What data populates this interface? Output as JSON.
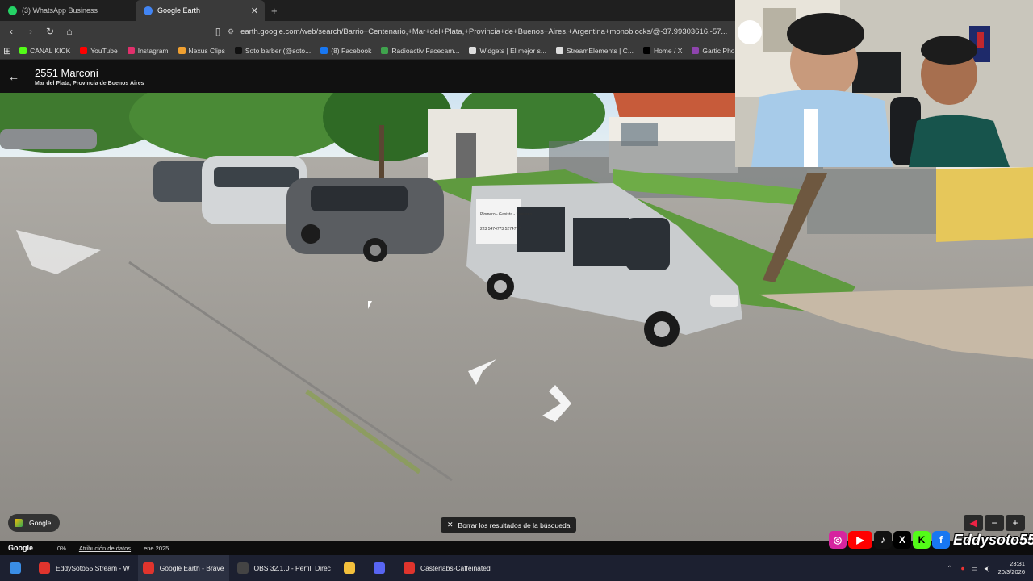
{
  "browser": {
    "tabs": [
      {
        "label": "(3) WhatsApp Business",
        "icon": "whatsapp-icon",
        "color": "#25d366"
      },
      {
        "label": "Google Earth",
        "icon": "google-earth-icon",
        "color": "#4285f4"
      }
    ],
    "url": "earth.google.com/web/search/Barrio+Centenario,+Mar+del+Plata,+Provincia+de+Buenos+Aires,+Argentina+monoblocks/@-37.99303616,-57...",
    "bookmarks": [
      {
        "label": "CANAL KICK",
        "color": "#53fc18"
      },
      {
        "label": "YouTube",
        "color": "#ff0000"
      },
      {
        "label": "Instagram",
        "color": "#e1306c"
      },
      {
        "label": "Nexus Clips",
        "color": "#f0a030"
      },
      {
        "label": "Soto barber (@soto...",
        "color": "#111111"
      },
      {
        "label": "(8) Facebook",
        "color": "#1877f2"
      },
      {
        "label": "Radioactiv Facecam...",
        "color": "#3fa34d"
      },
      {
        "label": "Widgets | El mejor s...",
        "color": "#dddddd"
      },
      {
        "label": "StreamElements | C...",
        "color": "#dddddd"
      },
      {
        "label": "Home / X",
        "color": "#000000"
      },
      {
        "label": "Gartic Phone - Tele",
        "color": "#8e44ad"
      }
    ]
  },
  "earth": {
    "place_title": "2551 Marconi",
    "place_subtitle": "Mar del Plata, Provincia de Buenos Aires",
    "google_chip": "Google",
    "clear_search": "Borrar los resultados de la búsqueda",
    "footer": {
      "brand": "Google",
      "percent": "0%",
      "attribution": "Atribución de datos",
      "date": "ene 2025"
    },
    "van_text": [
      "Plomero - Gasista - Sanitario",
      "223 5474773 5274777"
    ]
  },
  "overlay": {
    "streamer_name": "Eddysoto55"
  },
  "taskbar": {
    "items": [
      {
        "label": "EddySoto55 Stream - W",
        "color": "#e0342d"
      },
      {
        "label": "Google Earth - Brave",
        "color": "#e0342d"
      },
      {
        "label": "OBS 32.1.0 - Perfil: Direc",
        "color": "#444444"
      },
      {
        "label": "",
        "color": "#f3c03c"
      },
      {
        "label": "",
        "color": "#5865f2"
      },
      {
        "label": "Casterlabs-Caffeinated",
        "color": "#e0342d"
      }
    ],
    "time": "23:31",
    "date": "20/3/2026"
  }
}
